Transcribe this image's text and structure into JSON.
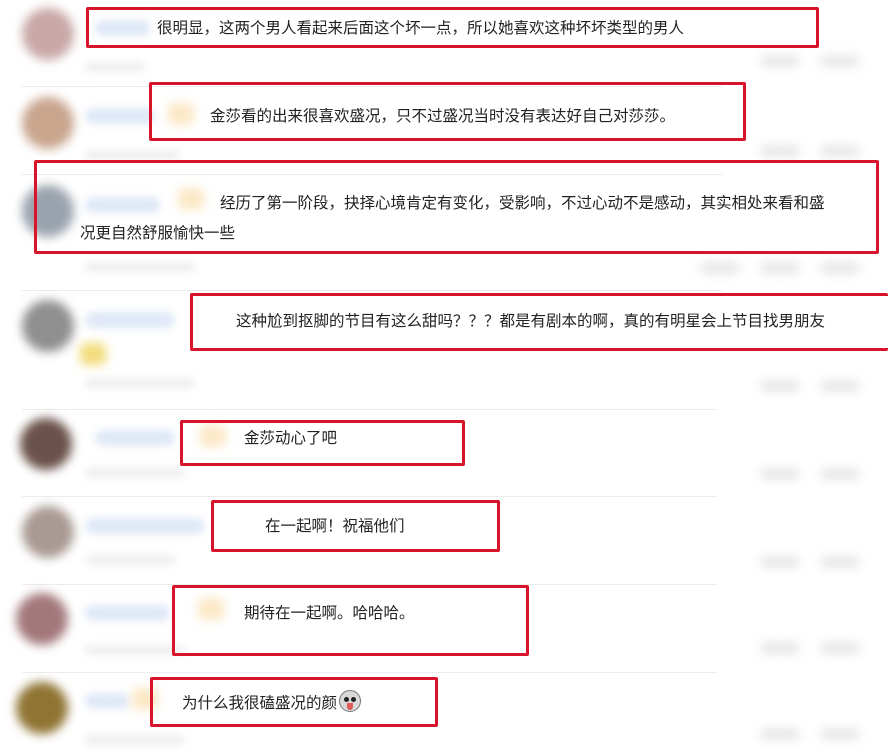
{
  "comments": [
    {
      "text": "很明显，这两个男人看起来后面这个坏一点，所以她喜欢这种坏坏类型的男人",
      "avatar_color": "#c9a7a7"
    },
    {
      "text": "金莎看的出来很喜欢盛况，只不过盛况当时没有表达好自己对莎莎。",
      "avatar_color": "#c9a58e"
    },
    {
      "text_line1": "经历了第一阶段，抉择心境肯定有变化，受影响，不过心动不是感动，其实相处来看和盛",
      "text_line2": "况更自然舒服愉快一些",
      "avatar_color": "#9aa3ad"
    },
    {
      "text": "这种尬到抠脚的节目有这么甜吗？？？都是有剧本的啊，真的有明星会上节目找男朋友",
      "avatar_color": "#8f8f8f"
    },
    {
      "text": "金莎动心了吧",
      "avatar_color": "#6a5149"
    },
    {
      "text": "在一起啊！祝福他们",
      "avatar_color": "#a99a93"
    },
    {
      "text": "期待在一起啊。哈哈哈。",
      "avatar_color": "#a3787c"
    },
    {
      "text": "为什么我很磕盛况的颜",
      "emoji": "crazy-face-emoji",
      "avatar_color": "#8f7433"
    }
  ],
  "highlight_color": "#d8142a"
}
